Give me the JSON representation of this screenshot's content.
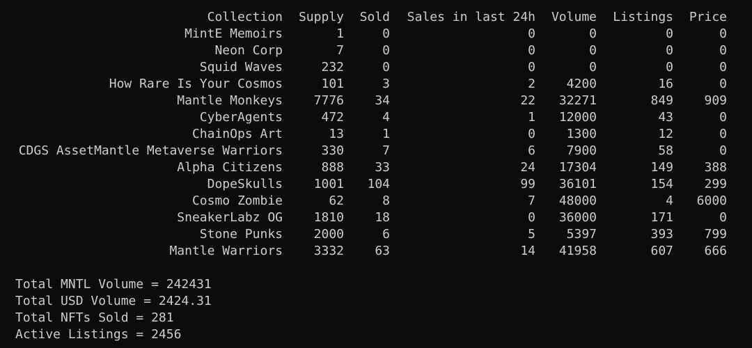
{
  "headers": {
    "collection": "Collection",
    "supply": "Supply",
    "sold": "Sold",
    "sales24h": "Sales in last 24h",
    "volume": "Volume",
    "listings": "Listings",
    "price": "Price"
  },
  "rows": [
    {
      "collection": "MintE Memoirs",
      "supply": "1",
      "sold": "0",
      "sales24h": "0",
      "volume": "0",
      "listings": "0",
      "price": "0"
    },
    {
      "collection": "Neon Corp",
      "supply": "7",
      "sold": "0",
      "sales24h": "0",
      "volume": "0",
      "listings": "0",
      "price": "0"
    },
    {
      "collection": "Squid Waves",
      "supply": "232",
      "sold": "0",
      "sales24h": "0",
      "volume": "0",
      "listings": "0",
      "price": "0"
    },
    {
      "collection": "How Rare Is Your Cosmos",
      "supply": "101",
      "sold": "3",
      "sales24h": "2",
      "volume": "4200",
      "listings": "16",
      "price": "0"
    },
    {
      "collection": "Mantle Monkeys",
      "supply": "7776",
      "sold": "34",
      "sales24h": "22",
      "volume": "32271",
      "listings": "849",
      "price": "909"
    },
    {
      "collection": "CyberAgents",
      "supply": "472",
      "sold": "4",
      "sales24h": "1",
      "volume": "12000",
      "listings": "43",
      "price": "0"
    },
    {
      "collection": "ChainOps Art",
      "supply": "13",
      "sold": "1",
      "sales24h": "0",
      "volume": "1300",
      "listings": "12",
      "price": "0"
    },
    {
      "collection": "CDGS AssetMantle Metaverse Warriors",
      "supply": "330",
      "sold": "7",
      "sales24h": "6",
      "volume": "7900",
      "listings": "58",
      "price": "0"
    },
    {
      "collection": "Alpha Citizens",
      "supply": "888",
      "sold": "33",
      "sales24h": "24",
      "volume": "17304",
      "listings": "149",
      "price": "388"
    },
    {
      "collection": "DopeSkulls",
      "supply": "1001",
      "sold": "104",
      "sales24h": "99",
      "volume": "36101",
      "listings": "154",
      "price": "299"
    },
    {
      "collection": "Cosmo Zombie",
      "supply": "62",
      "sold": "8",
      "sales24h": "7",
      "volume": "48000",
      "listings": "4",
      "price": "6000"
    },
    {
      "collection": "SneakerLabz OG",
      "supply": "1810",
      "sold": "18",
      "sales24h": "0",
      "volume": "36000",
      "listings": "171",
      "price": "0"
    },
    {
      "collection": "Stone Punks",
      "supply": "2000",
      "sold": "6",
      "sales24h": "5",
      "volume": "5397",
      "listings": "393",
      "price": "799"
    },
    {
      "collection": "Mantle Warriors",
      "supply": "3332",
      "sold": "63",
      "sales24h": "14",
      "volume": "41958",
      "listings": "607",
      "price": "666"
    }
  ],
  "summary": {
    "mntl_volume": "Total MNTL Volume = 242431",
    "usd_volume": "Total USD Volume = 2424.31",
    "nfts_sold": "Total NFTs Sold = 281",
    "active_listings": "Active Listings = 2456"
  },
  "colors": {
    "background": "#0c0c0c",
    "text": "#cccccc"
  }
}
